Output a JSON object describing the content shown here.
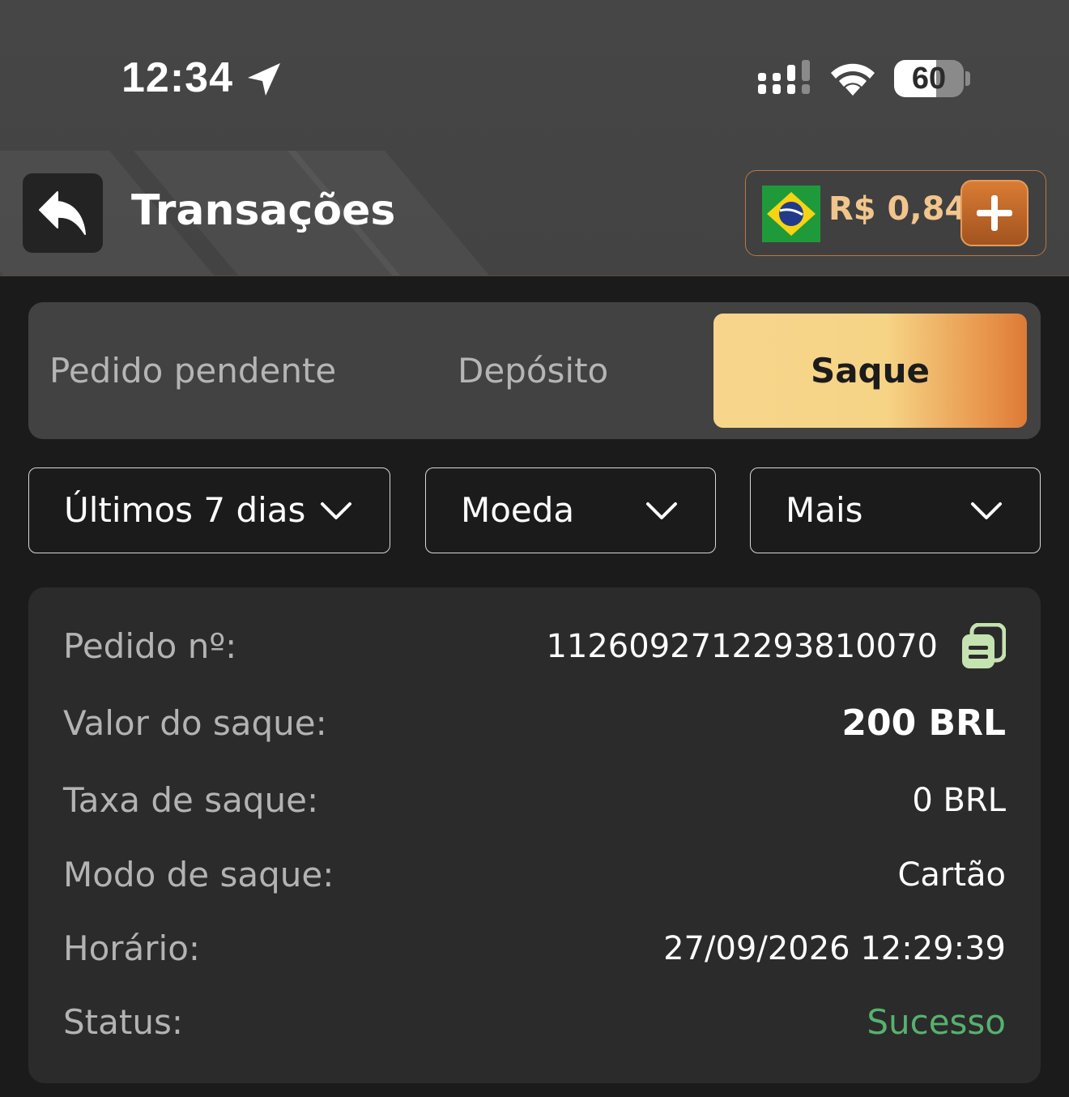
{
  "status_bar": {
    "time": "12:34",
    "battery_level": "60",
    "battery_percent": 60
  },
  "header": {
    "title": "Transações",
    "back_icon": "reply-arrow-icon",
    "balance": "R$ 0,84",
    "flag_icon": "brazil-flag-icon",
    "add_icon": "plus-icon"
  },
  "tabs": [
    {
      "label": "Pedido pendente",
      "active": false
    },
    {
      "label": "Depósito",
      "active": false
    },
    {
      "label": "Saque",
      "active": true
    }
  ],
  "filters": {
    "period": "Últimos 7 dias",
    "currency": "Moeda",
    "more": "Mais"
  },
  "transaction": {
    "order_label": "Pedido nº:",
    "order_value": "1126092712293810070",
    "amount_label": "Valor do saque:",
    "amount_value": "200 BRL",
    "fee_label": "Taxa de saque:",
    "fee_value": "0 BRL",
    "mode_label": "Modo de saque:",
    "mode_value": "Cartão",
    "time_label": "Horário:",
    "time_value": "27/09/2026 12:29:39",
    "status_label": "Status:",
    "status_value": "Sucesso"
  },
  "colors": {
    "accent": "#f6d486",
    "accent_end": "#de7a35",
    "success": "#56b26f",
    "balance": "#f1c58c"
  }
}
